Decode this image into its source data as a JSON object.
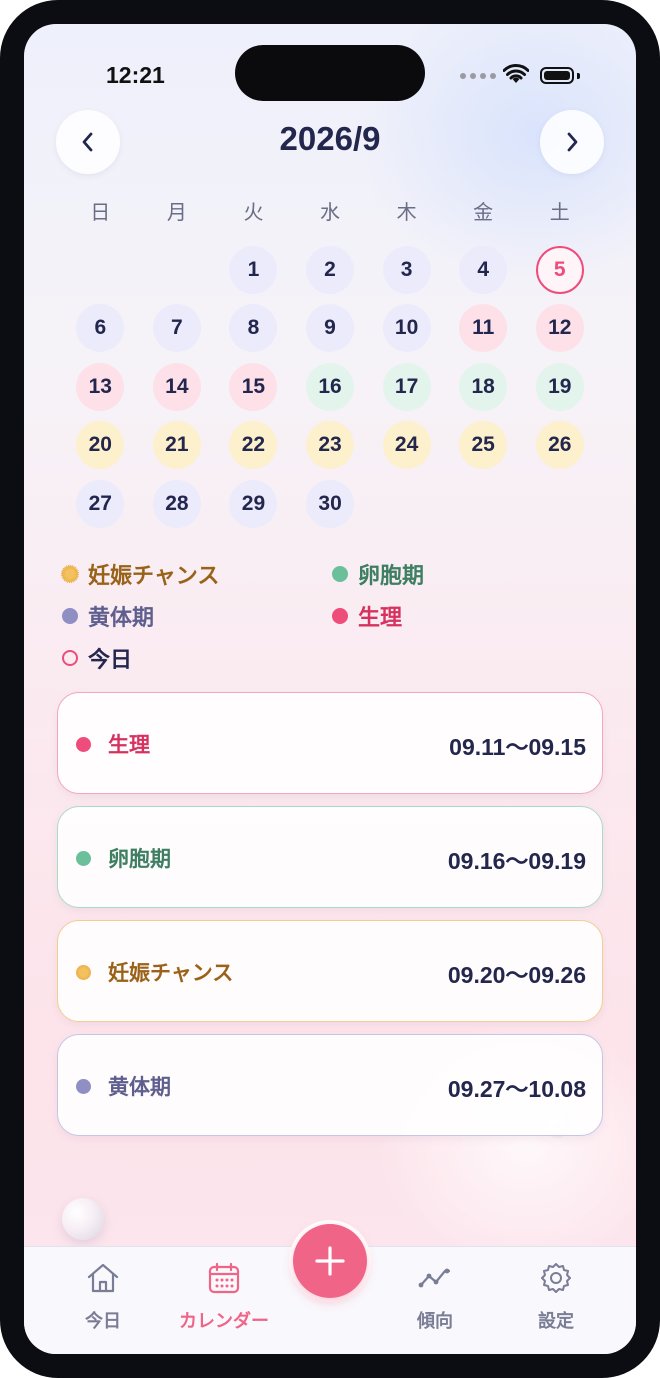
{
  "status_bar": {
    "time": "12:21"
  },
  "header": {
    "title": "2026/9",
    "prev_icon": "chevron-left",
    "next_icon": "chevron-right"
  },
  "weekdays": [
    "日",
    "月",
    "火",
    "水",
    "木",
    "金",
    "土"
  ],
  "calendar": {
    "leading_blanks": 2,
    "today": 5,
    "days": [
      {
        "d": "1",
        "phase": "luteal"
      },
      {
        "d": "2",
        "phase": "luteal"
      },
      {
        "d": "3",
        "phase": "luteal"
      },
      {
        "d": "4",
        "phase": "luteal"
      },
      {
        "d": "5",
        "phase": "today"
      },
      {
        "d": "6",
        "phase": "luteal"
      },
      {
        "d": "7",
        "phase": "luteal"
      },
      {
        "d": "8",
        "phase": "luteal"
      },
      {
        "d": "9",
        "phase": "luteal"
      },
      {
        "d": "10",
        "phase": "luteal"
      },
      {
        "d": "11",
        "phase": "period"
      },
      {
        "d": "12",
        "phase": "period"
      },
      {
        "d": "13",
        "phase": "period"
      },
      {
        "d": "14",
        "phase": "period"
      },
      {
        "d": "15",
        "phase": "period"
      },
      {
        "d": "16",
        "phase": "follicular"
      },
      {
        "d": "17",
        "phase": "follicular"
      },
      {
        "d": "18",
        "phase": "follicular"
      },
      {
        "d": "19",
        "phase": "follicular"
      },
      {
        "d": "20",
        "phase": "fertile"
      },
      {
        "d": "21",
        "phase": "fertile"
      },
      {
        "d": "22",
        "phase": "fertile"
      },
      {
        "d": "23",
        "phase": "fertile"
      },
      {
        "d": "24",
        "phase": "fertile"
      },
      {
        "d": "25",
        "phase": "fertile"
      },
      {
        "d": "26",
        "phase": "fertile"
      },
      {
        "d": "27",
        "phase": "luteal"
      },
      {
        "d": "28",
        "phase": "luteal"
      },
      {
        "d": "29",
        "phase": "luteal"
      },
      {
        "d": "30",
        "phase": "luteal"
      }
    ]
  },
  "colors": {
    "period": "#ee4d7c",
    "period_bg": "#fde0e8",
    "follicular": "#6bbf9b",
    "follicular_bg": "#e2f4ec",
    "fertile": "#e7a23a",
    "fertile_bg": "#fdf0cc",
    "luteal": "#8f8fc4",
    "luteal_bg": "#ebebfb",
    "text": "#23264d",
    "accent": "#f06488"
  },
  "legend": {
    "fertile": "妊娠チャンス",
    "follicular": "卵胞期",
    "luteal": "黄体期",
    "period": "生理",
    "today": "今日"
  },
  "cards": [
    {
      "label": "生理",
      "range": "09.11～09.15",
      "phase": "period"
    },
    {
      "label": "卵胞期",
      "range": "09.16～09.19",
      "phase": "follicular"
    },
    {
      "label": "妊娠チャンス",
      "range": "09.20～09.26",
      "phase": "fertile"
    },
    {
      "label": "黄体期",
      "range": "09.27～10.08",
      "phase": "luteal"
    }
  ],
  "tabbar": {
    "today": "今日",
    "calendar": "カレンダー",
    "trend": "傾向",
    "settings": "設定",
    "active": "calendar"
  }
}
